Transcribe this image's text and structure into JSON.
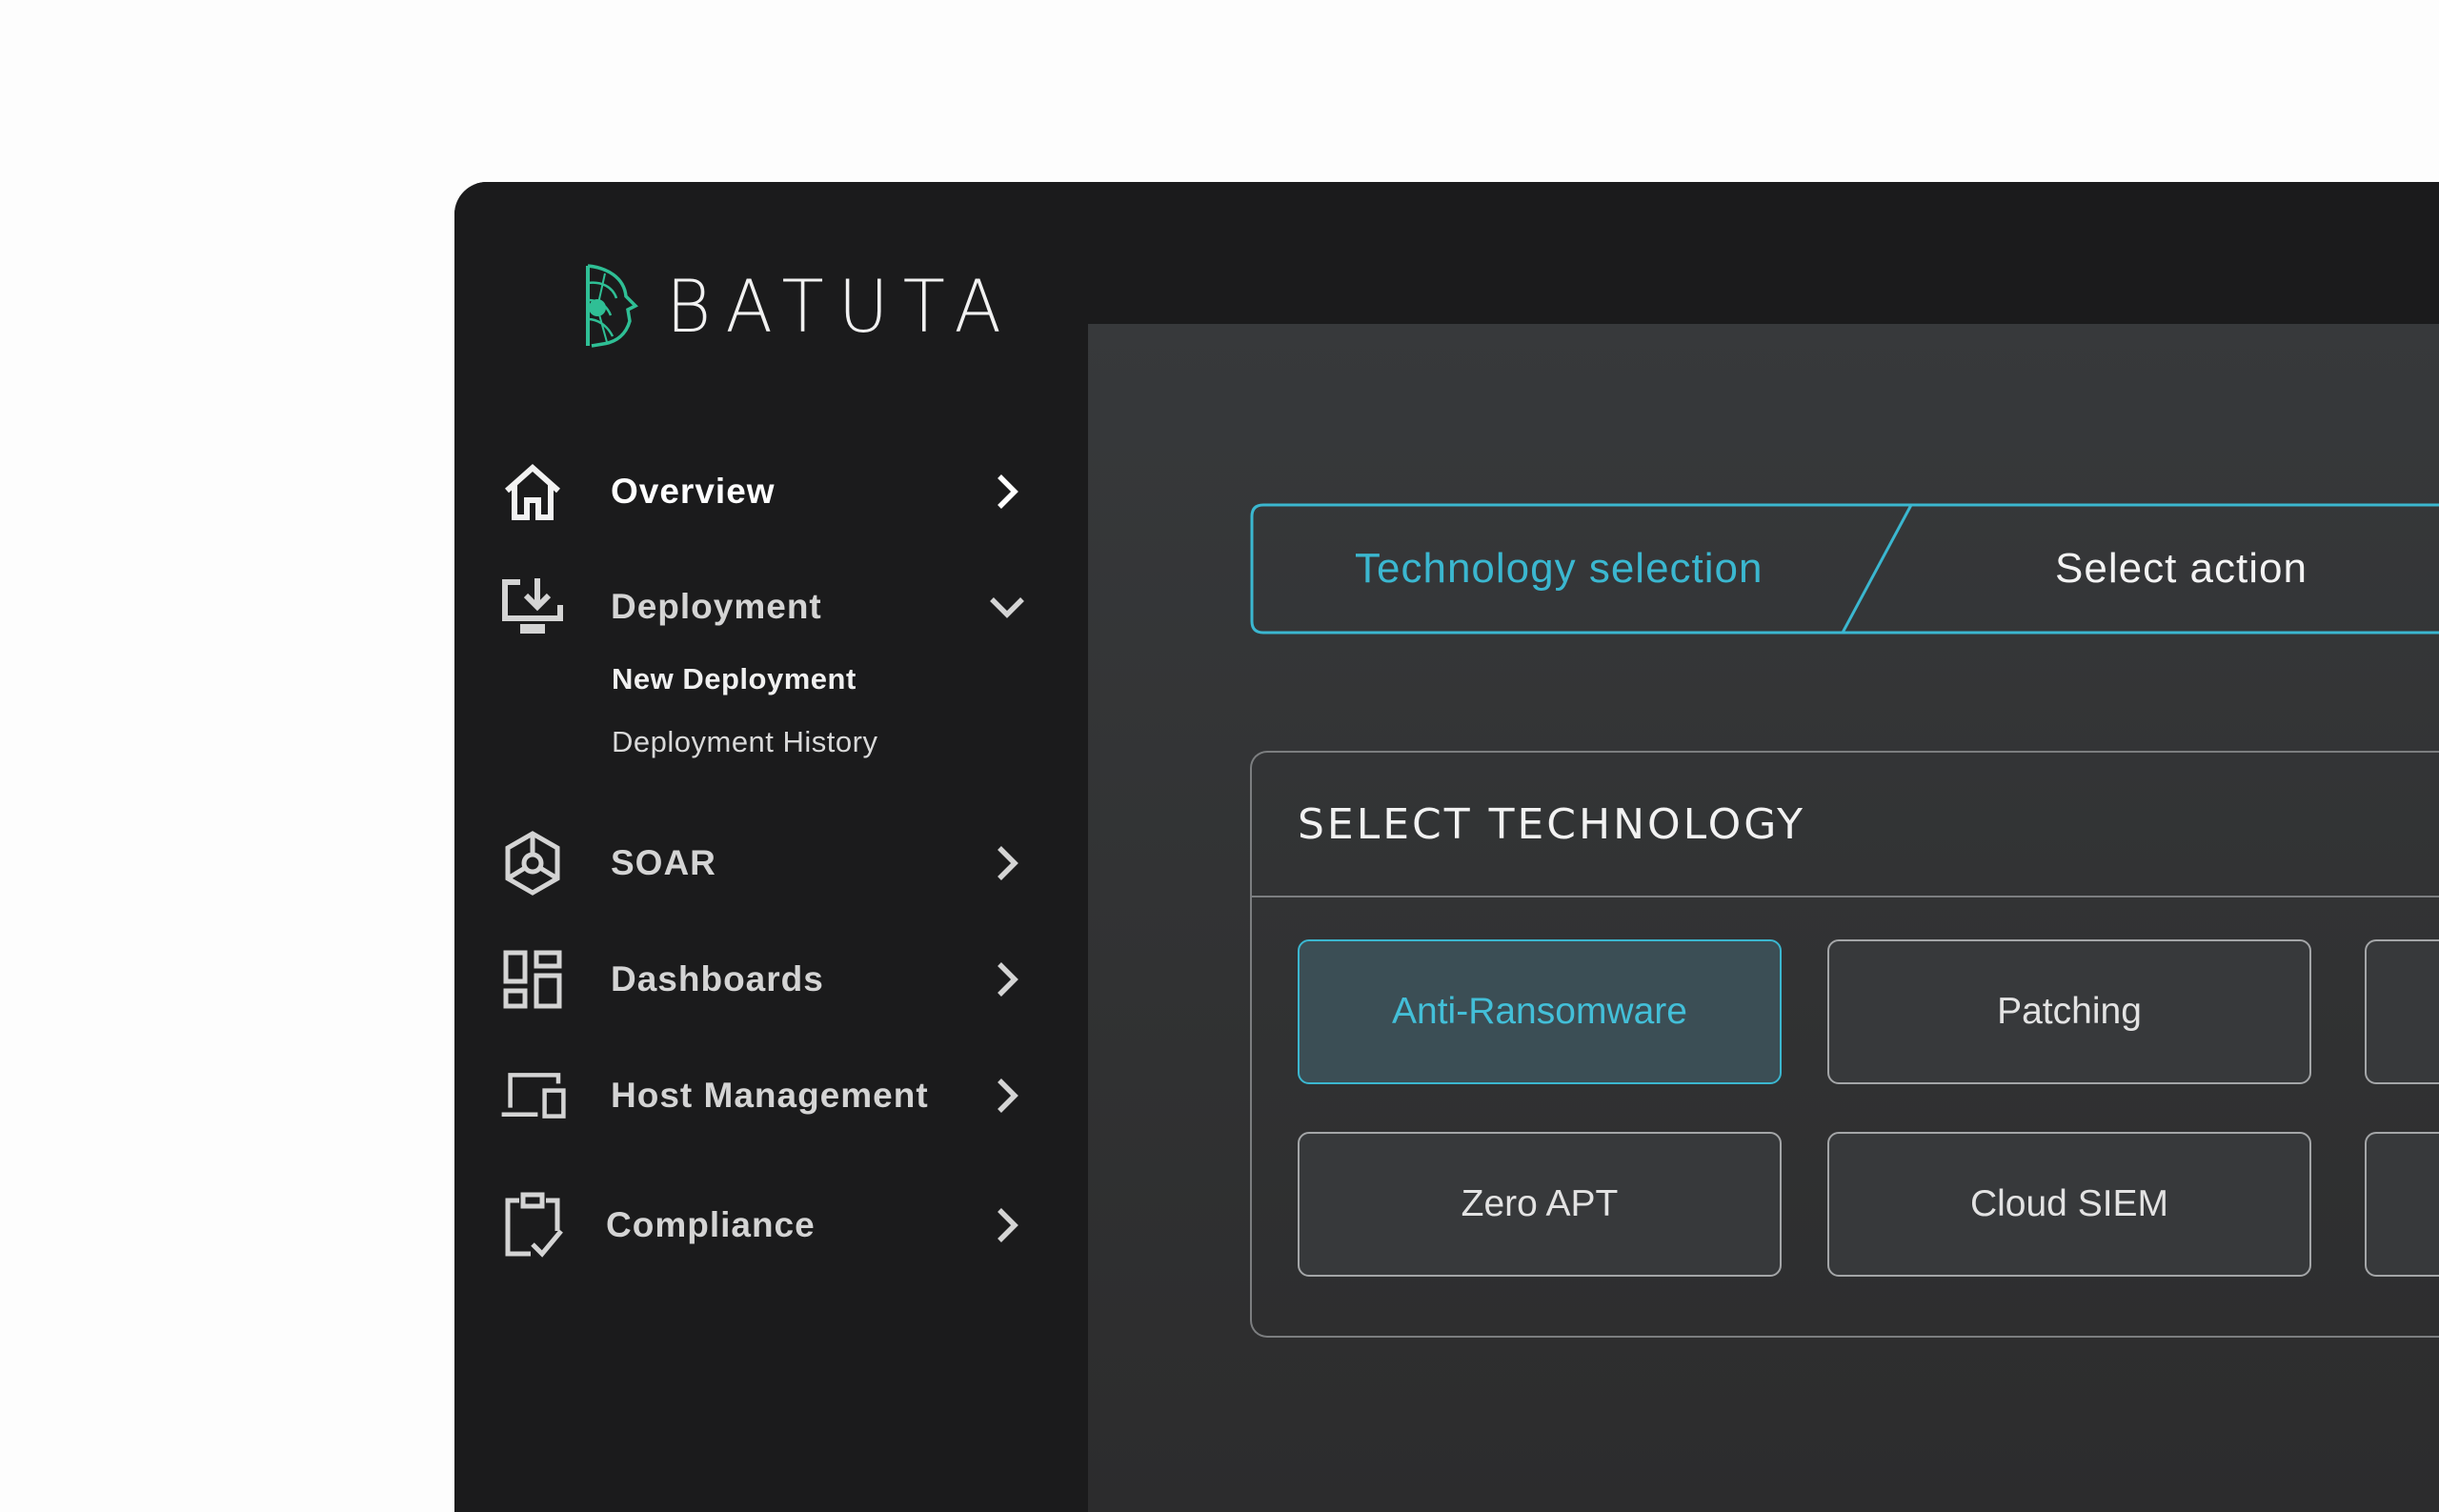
{
  "app": {
    "brand": "BATUTA"
  },
  "sidebar": {
    "items": [
      {
        "label": "Overview",
        "icon": "home-icon",
        "chevron": "chevron-right-icon"
      },
      {
        "label": "Deployment",
        "icon": "download-monitor-icon",
        "chevron": "chevron-down-icon",
        "children": [
          {
            "label": "New Deployment"
          },
          {
            "label": "Deployment History"
          }
        ]
      },
      {
        "label": "SOAR",
        "icon": "hexagon-cube-icon",
        "chevron": "chevron-right-icon"
      },
      {
        "label": "Dashboards",
        "icon": "dashboard-grid-icon",
        "chevron": "chevron-right-icon"
      },
      {
        "label": "Host Management",
        "icon": "devices-icon",
        "chevron": "chevron-right-icon"
      },
      {
        "label": "Compliance",
        "icon": "clipboard-check-icon",
        "chevron": "chevron-right-icon"
      }
    ]
  },
  "stepper": {
    "steps": [
      {
        "label": "Technology selection",
        "state": "active"
      },
      {
        "label": "Select action",
        "state": "upcoming"
      }
    ]
  },
  "technology": {
    "title": "SELECT TECHNOLOGY",
    "options": [
      {
        "label": "Anti-Ransomware",
        "selected": true
      },
      {
        "label": "Patching",
        "selected": false
      },
      {
        "label": "Zero APT",
        "selected": false
      },
      {
        "label": "Cloud SIEM",
        "selected": false
      }
    ]
  },
  "colors": {
    "accent": "#3bb7d0",
    "sidebar_bg": "#1b1b1c",
    "panel_bg": "#37393b",
    "logo_green": "#2fbf95"
  }
}
